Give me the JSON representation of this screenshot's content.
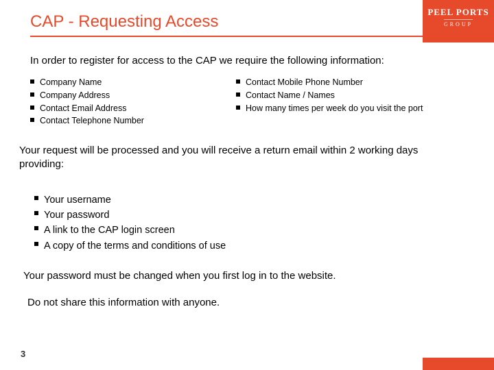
{
  "header": {
    "title": "CAP - Requesting Access",
    "logo_line1": "PEEL PORTS",
    "logo_line2": "GROUP"
  },
  "intro": "In order to register for access to the CAP we require the following information:",
  "req_left": [
    "Company Name",
    "Company Address",
    "Contact Email Address",
    "Contact Telephone Number"
  ],
  "req_right": [
    "Contact Mobile Phone Number",
    "Contact Name / Names",
    "How many times per week do you visit the port"
  ],
  "processed_text": "Your request will be processed and you will receive a return email within 2 working days providing:",
  "provides": [
    "Your username",
    "Your password",
    "A link to the CAP login screen",
    "A copy of the terms and conditions of use"
  ],
  "warn_change": "Your password must be changed when you first log in to the website.",
  "warn_share": "Do not share this information with anyone.",
  "page_number": "3",
  "colors": {
    "accent": "#e74a2b"
  }
}
